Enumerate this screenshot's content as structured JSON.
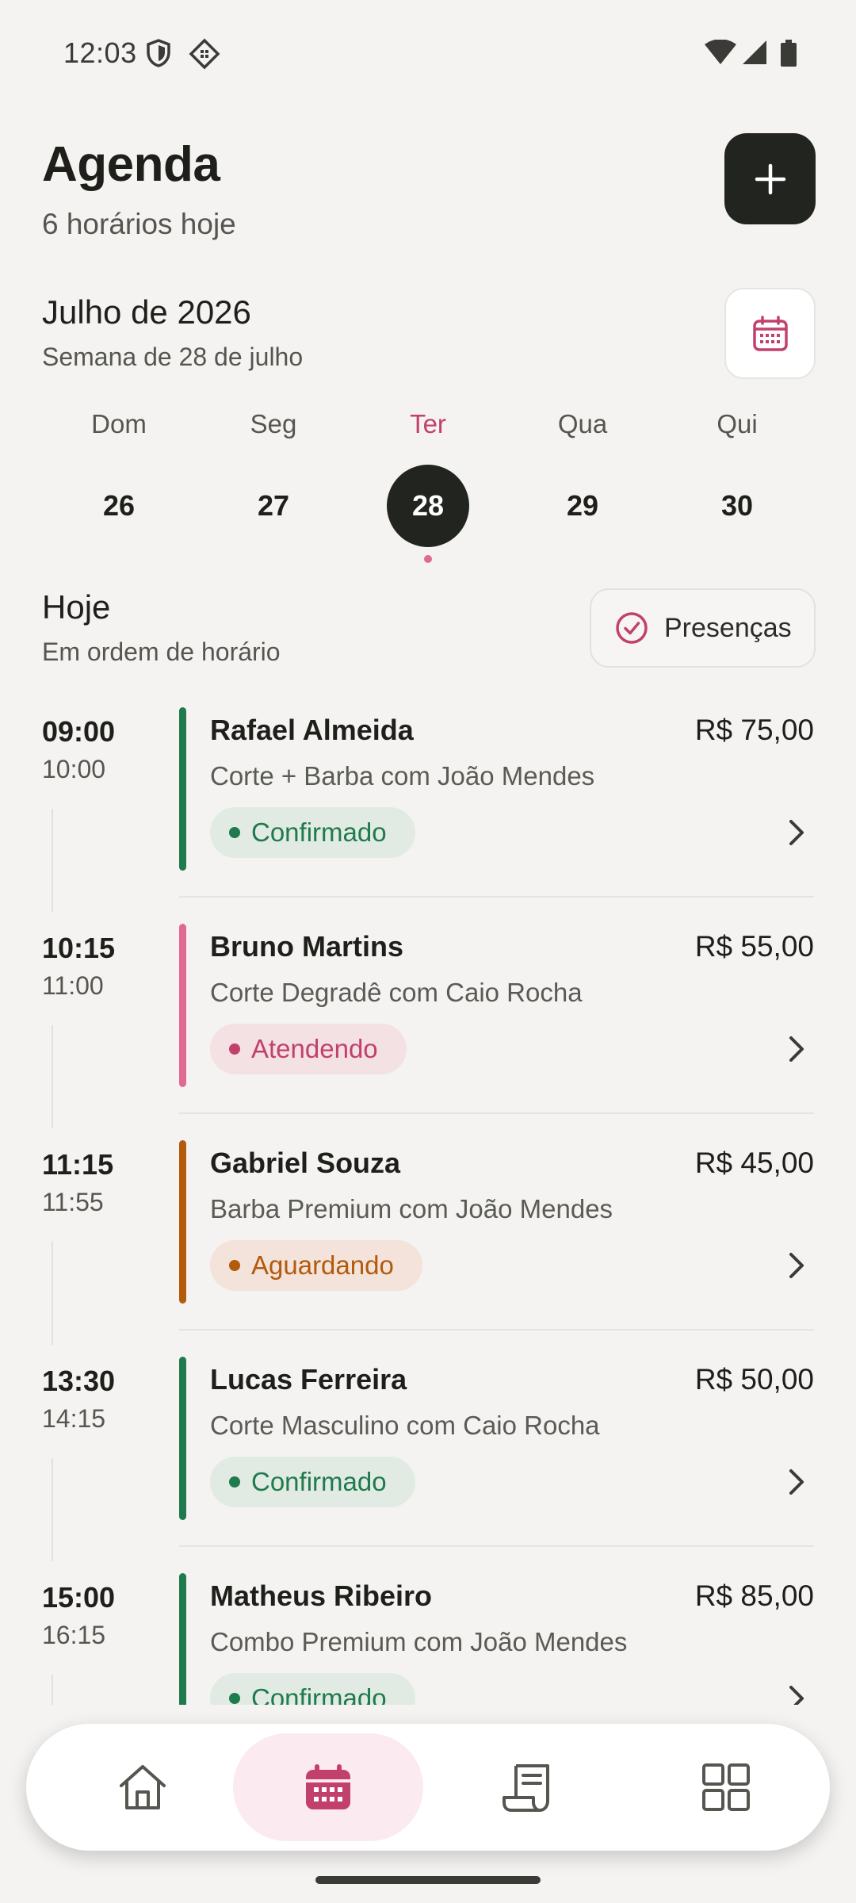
{
  "status_bar": {
    "time": "12:03"
  },
  "header": {
    "title": "Agenda",
    "subtitle": "6 horários hoje"
  },
  "calendar": {
    "month": "Julho de 2026",
    "week": "Semana de 28 de julho",
    "days": [
      {
        "name": "Dom",
        "num": "26"
      },
      {
        "name": "Seg",
        "num": "27"
      },
      {
        "name": "Ter",
        "num": "28",
        "active": true
      },
      {
        "name": "Qua",
        "num": "29"
      },
      {
        "name": "Qui",
        "num": "30"
      }
    ]
  },
  "section": {
    "title": "Hoje",
    "subtitle": "Em ordem de horário",
    "presence_button": "Presenças"
  },
  "appointments": [
    {
      "start": "09:00",
      "end": "10:00",
      "client": "Rafael Almeida",
      "price": "R$ 75,00",
      "service": "Corte + Barba com João Mendes",
      "status": "Confirmado"
    },
    {
      "start": "10:15",
      "end": "11:00",
      "client": "Bruno Martins",
      "price": "R$ 55,00",
      "service": "Corte Degradê com Caio Rocha",
      "status": "Atendendo"
    },
    {
      "start": "11:15",
      "end": "11:55",
      "client": "Gabriel Souza",
      "price": "R$ 45,00",
      "service": "Barba Premium com João Mendes",
      "status": "Aguardando"
    },
    {
      "start": "13:30",
      "end": "14:15",
      "client": "Lucas Ferreira",
      "price": "R$ 50,00",
      "service": "Corte Masculino com Caio Rocha",
      "status": "Confirmado"
    },
    {
      "start": "15:00",
      "end": "16:15",
      "client": "Matheus Ribeiro",
      "price": "R$ 85,00",
      "service": "Combo Premium com João Mendes",
      "status": "Confirmado"
    }
  ],
  "status_colors": {
    "Confirmado": {
      "bar": "#1F7A4D",
      "bg": "#E1EBE3",
      "text": "#1F7A4D"
    },
    "Atendendo": {
      "bar": "#E06A93",
      "bg": "#F4E1E4",
      "text": "#C2416C"
    },
    "Aguardando": {
      "bar": "#B35A0C",
      "bg": "#F3E3DA",
      "text": "#B35A0C"
    }
  },
  "nav": {
    "items": [
      "home-icon",
      "calendar-icon",
      "receipt-icon",
      "grid-icon"
    ],
    "active": "calendar-icon"
  },
  "colors": {
    "accent": "#C2416C",
    "dark": "#22241F",
    "background": "#F4F3F1"
  }
}
